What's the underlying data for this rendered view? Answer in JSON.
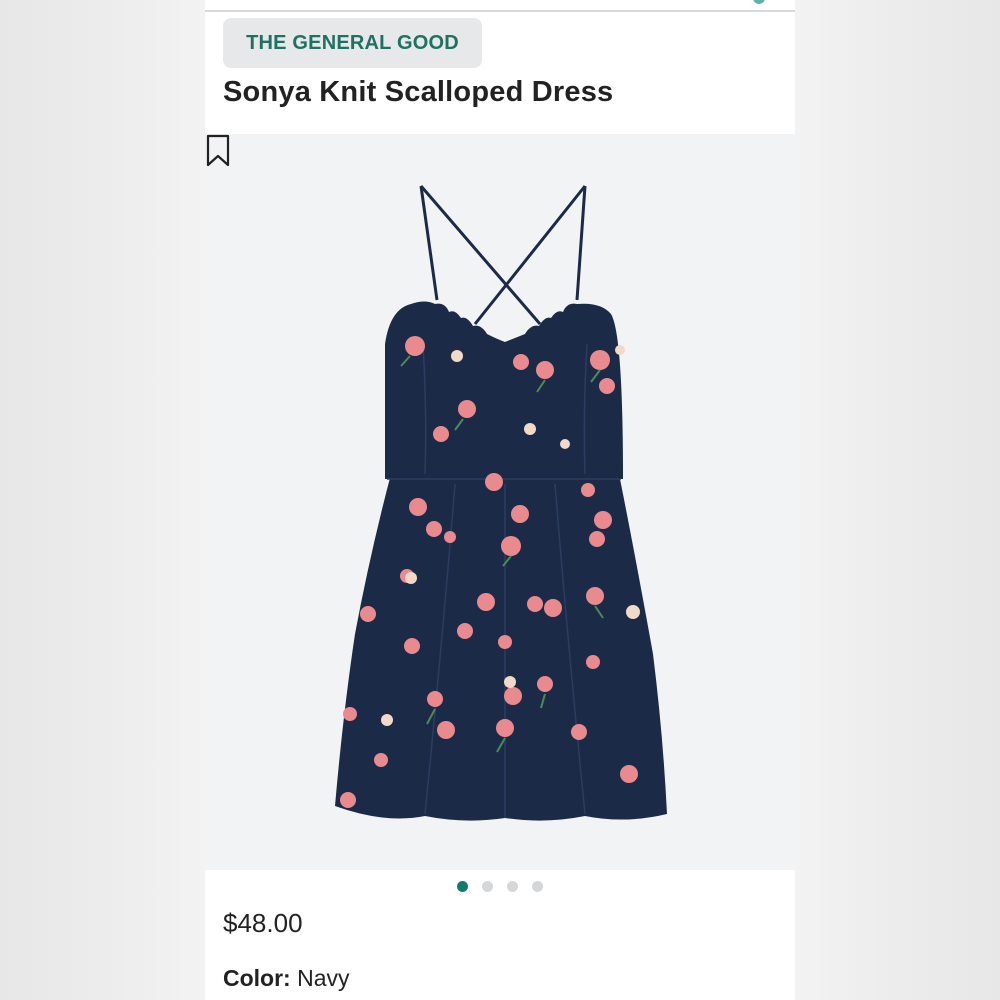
{
  "product": {
    "brand": "THE GENERAL GOOD",
    "title": "Sonya Knit Scalloped Dress",
    "price": "$48.00",
    "color_label": "Color:",
    "color_value": "Navy"
  },
  "gallery": {
    "total_images": 4,
    "active_index": 0,
    "image_subject": "navy floral scalloped slip dress",
    "icon": "bookmark-icon"
  },
  "colors": {
    "brand_text": "#1f7163",
    "active_dot": "#0f7c6d",
    "dress": "#1b2a47",
    "flower": "#e98a8f"
  }
}
